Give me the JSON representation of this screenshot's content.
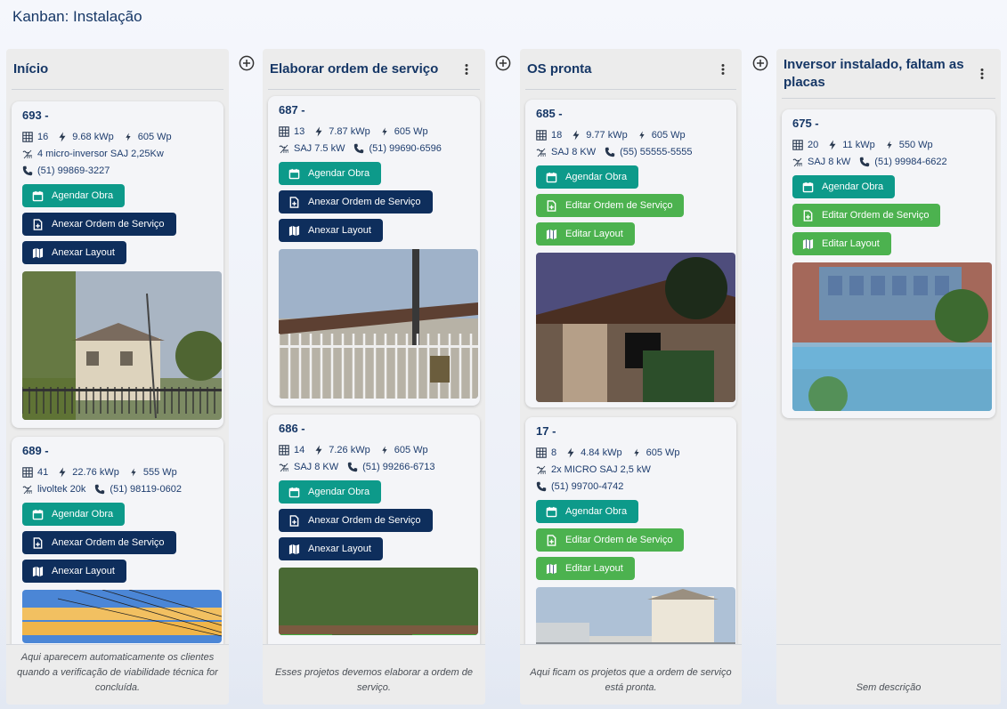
{
  "page": {
    "title": "Kanban: Instalação"
  },
  "colors": {
    "teal": "#0d9a8a",
    "navy": "#0e2e5c",
    "green": "#4cb24f",
    "title": "#163766"
  },
  "columns": [
    {
      "title": "Início",
      "description": "Aqui aparecem automaticamente os clientes quando a verificação de viabilidade técnica for concluída.",
      "cards": [
        {
          "id": "693 -",
          "modules": "16",
          "power": "9.68 kWp",
          "panel": "605 Wp",
          "inverter": "4 micro-inversor SAJ 2,25Kw",
          "phone": "(51) 99869-3227",
          "buttons": [
            "Agendar Obra",
            "Anexar Ordem de Serviço",
            "Anexar Layout"
          ]
        },
        {
          "id": "689 -",
          "modules": "41",
          "power": "22.76 kWp",
          "panel": "555 Wp",
          "inverter": "livoltek 20k",
          "phone": "(51) 98119-0602",
          "buttons": [
            "Agendar Obra",
            "Anexar Ordem de Serviço",
            "Anexar Layout"
          ]
        }
      ]
    },
    {
      "title": "Elaborar ordem de serviço",
      "description": "Esses projetos devemos elaborar a ordem de serviço.",
      "cards": [
        {
          "id": "687 -",
          "modules": "13",
          "power": "7.87 kWp",
          "panel": "605 Wp",
          "inverter": "SAJ 7.5 kW",
          "phone": "(51) 99690-6596",
          "buttons": [
            "Agendar Obra",
            "Anexar Ordem de Serviço",
            "Anexar Layout"
          ]
        },
        {
          "id": "686 -",
          "modules": "14",
          "power": "7.26 kWp",
          "panel": "605 Wp",
          "inverter": "SAJ 8 KW",
          "phone": "(51) 99266-6713",
          "buttons": [
            "Agendar Obra",
            "Anexar Ordem de Serviço",
            "Anexar Layout"
          ]
        }
      ]
    },
    {
      "title": "OS pronta",
      "description": "Aqui ficam os projetos que a ordem de serviço está pronta.",
      "cards": [
        {
          "id": "685 -",
          "modules": "18",
          "power": "9.77 kWp",
          "panel": "605 Wp",
          "inverter": "SAJ 8 KW",
          "phone": "(55) 55555-5555",
          "buttons": [
            "Agendar Obra",
            "Editar Ordem de Serviço",
            "Editar Layout"
          ]
        },
        {
          "id": "17 -",
          "modules": "8",
          "power": "4.84 kWp",
          "panel": "605 Wp",
          "inverter": "2x MICRO SAJ 2,5 kW",
          "phone": "(51) 99700-4742",
          "buttons": [
            "Agendar Obra",
            "Editar Ordem de Serviço",
            "Editar Layout"
          ]
        }
      ]
    },
    {
      "title": "Inversor instalado, faltam as placas",
      "description": "Sem descrição",
      "cards": [
        {
          "id": "675 -",
          "modules": "20",
          "power": "11 kWp",
          "panel": "550 Wp",
          "inverter": "SAJ 8 kW",
          "phone": "(51) 99984-6622",
          "buttons": [
            "Agendar Obra",
            "Editar Ordem de Serviço",
            "Editar Layout"
          ]
        }
      ]
    }
  ]
}
